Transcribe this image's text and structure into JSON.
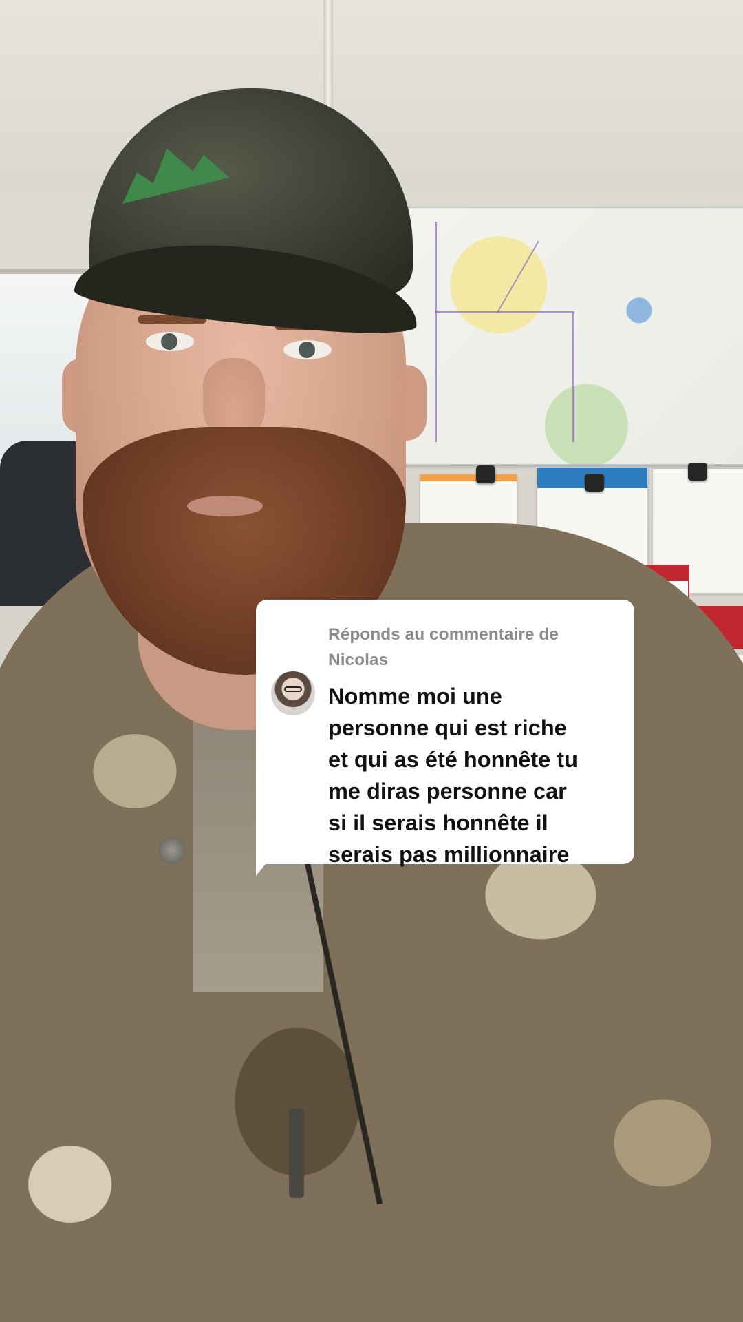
{
  "reply_bubble": {
    "header_line1": "Réponds au commentaire de",
    "header_line2": "Nicolas",
    "comment_text": "Nomme moi une\npersonne qui est riche\net qui as été honnête tu\nme diras personne car\nsi il serais honnête il\nserais pas millionnaire",
    "avatar_icon": "commenter-avatar"
  },
  "colors": {
    "bubble_background": "#ffffff",
    "header_text": "#8c8c8c",
    "comment_text": "#111111"
  }
}
